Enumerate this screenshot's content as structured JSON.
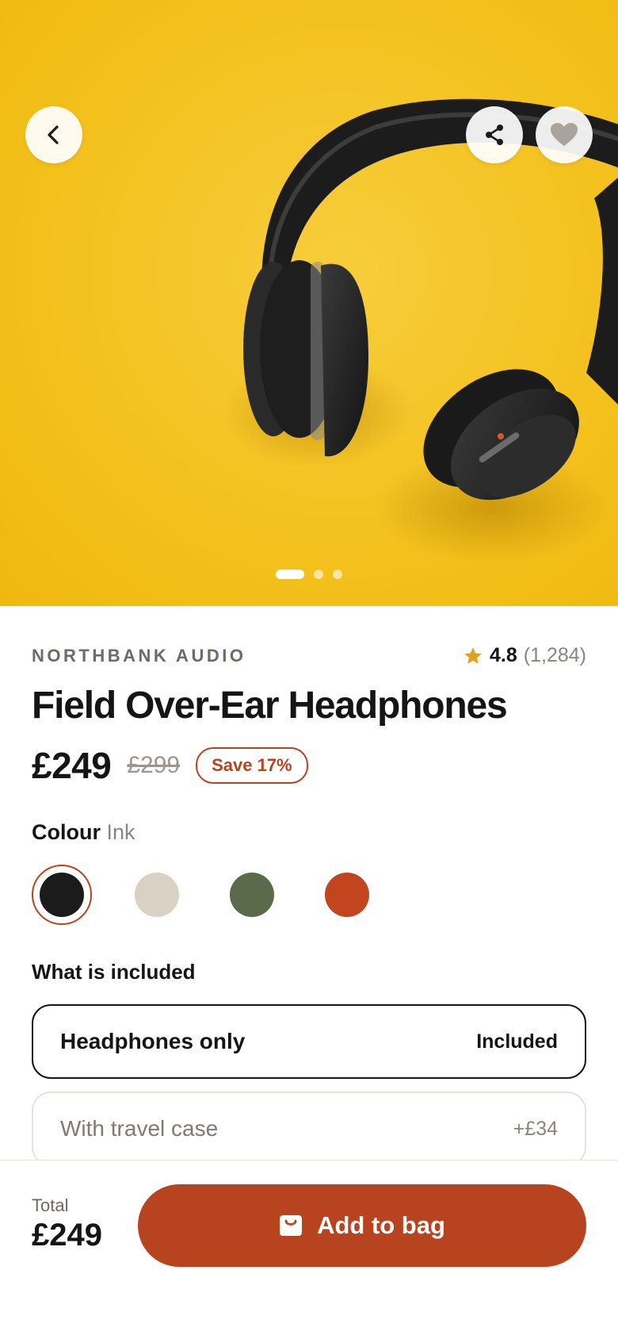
{
  "hero": {
    "back_icon": "chevron-left-icon",
    "share_icon": "share-icon",
    "favorite_icon": "heart-icon",
    "carousel": {
      "total": 3,
      "active_index": 0
    }
  },
  "product": {
    "brand": "NORTHBANK AUDIO",
    "rating": "4.8",
    "review_count": "(1,284)",
    "rating_icon": "star-icon",
    "title": "Field Over-Ear Headphones",
    "price": "£249",
    "original_price": "£299",
    "save_badge": "Save 17%"
  },
  "colour": {
    "label": "Colour",
    "selected_name": "Ink",
    "swatches": [
      {
        "color": "#1b1b1b",
        "selected": true
      },
      {
        "color": "#d9d1c3",
        "selected": false
      },
      {
        "color": "#5a6a4a",
        "selected": false
      },
      {
        "color": "#c2451f",
        "selected": false
      }
    ]
  },
  "included": {
    "label": "What is included",
    "options": [
      {
        "name": "Headphones only",
        "price": "Included",
        "selected": true
      },
      {
        "name": "With travel case",
        "price": "+£34",
        "selected": false
      }
    ]
  },
  "bottom_bar": {
    "total_label": "Total",
    "total_value": "£249",
    "button_label": "Add to bag",
    "button_icon": "shopping-bag-icon"
  },
  "colors": {
    "accent": "#b8431f",
    "hero_background": "#f4c21f",
    "star": "#e0a21a"
  }
}
